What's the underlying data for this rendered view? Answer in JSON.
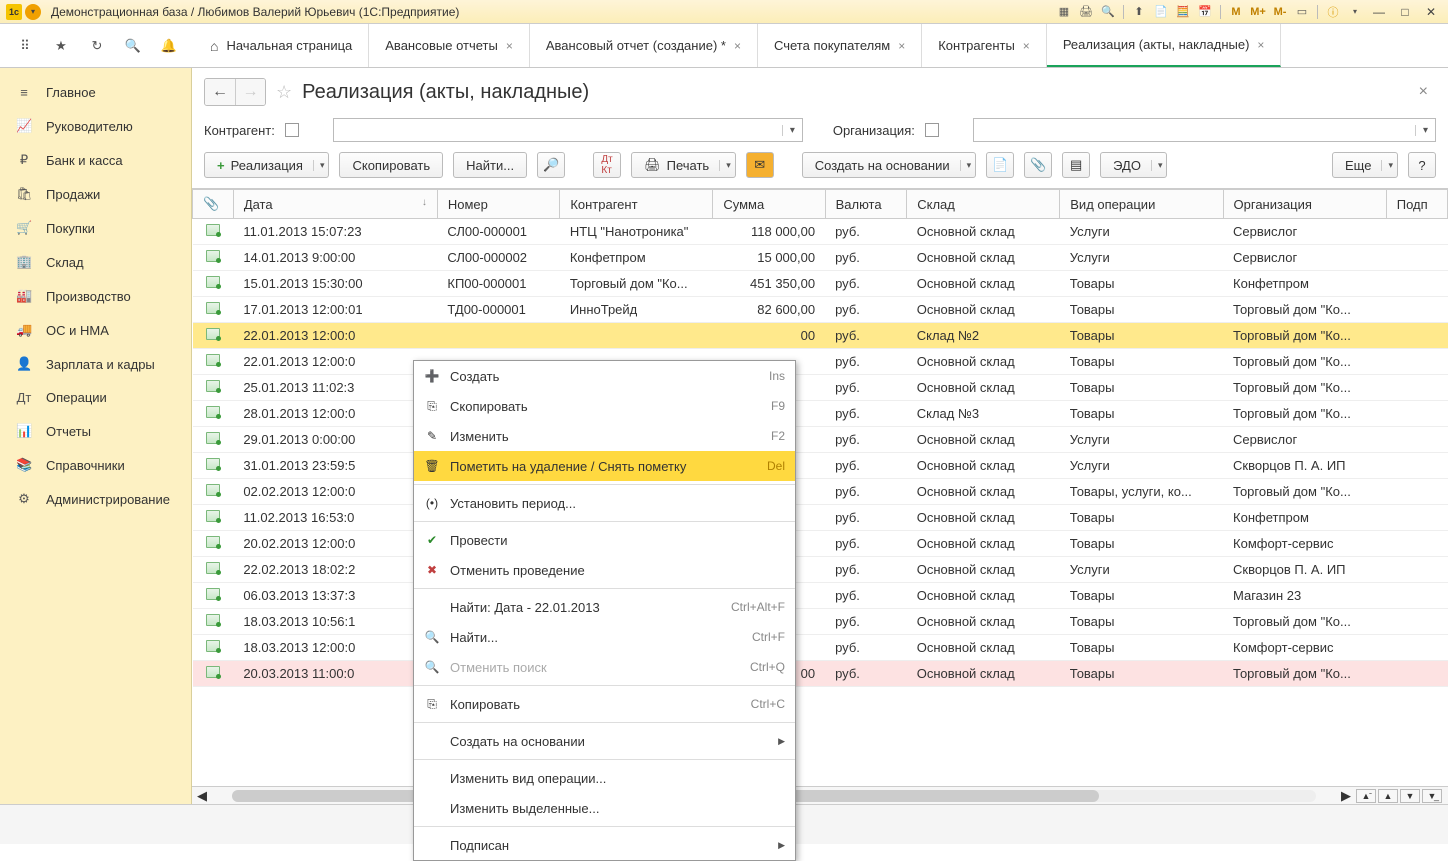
{
  "window": {
    "title": "Демонстрационная база / Любимов Валерий Юрьевич  (1С:Предприятие)"
  },
  "titlebar_right": {
    "m": "M",
    "mp": "M+",
    "mm": "M-"
  },
  "tabs": {
    "home": "Начальная страница",
    "t1": "Авансовые отчеты",
    "t2": "Авансовый отчет (создание) *",
    "t3": "Счета покупателям",
    "t4": "Контрагенты",
    "t5": "Реализация (акты, накладные)"
  },
  "sidebar": [
    {
      "icon": "≡",
      "label": "Главное"
    },
    {
      "icon": "📈",
      "label": "Руководителю"
    },
    {
      "icon": "₽",
      "label": "Банк и касса"
    },
    {
      "icon": "🛍",
      "label": "Продажи"
    },
    {
      "icon": "🛒",
      "label": "Покупки"
    },
    {
      "icon": "🏢",
      "label": "Склад"
    },
    {
      "icon": "🏭",
      "label": "Производство"
    },
    {
      "icon": "🚚",
      "label": "ОС и НМА"
    },
    {
      "icon": "👤",
      "label": "Зарплата и кадры"
    },
    {
      "icon": "Дт",
      "label": "Операции"
    },
    {
      "icon": "📊",
      "label": "Отчеты"
    },
    {
      "icon": "📚",
      "label": "Справочники"
    },
    {
      "icon": "⚙",
      "label": "Администрирование"
    }
  ],
  "page": {
    "title": "Реализация (акты, накладные)"
  },
  "filters": {
    "contragent_label": "Контрагент:",
    "org_label": "Организация:"
  },
  "actions": {
    "create": "Реализация",
    "copy": "Скопировать",
    "find": "Найти...",
    "print": "Печать",
    "create_on_basis": "Создать на основании",
    "edo": "ЭДО",
    "more": "Еще",
    "help": "?"
  },
  "columns": {
    "attach": "📎",
    "date": "Дата",
    "number": "Номер",
    "contragent": "Контрагент",
    "sum": "Сумма",
    "currency": "Валюта",
    "warehouse": "Склад",
    "optype": "Вид операции",
    "org": "Организация",
    "signer": "Подп"
  },
  "rows": [
    {
      "date": "11.01.2013 15:07:23",
      "number": "СЛ00-000001",
      "contr": "НТЦ \"Нанотроника\"",
      "sum": "118 000,00",
      "cur": "руб.",
      "wh": "Основной склад",
      "op": "Услуги",
      "org": "Сервислог"
    },
    {
      "date": "14.01.2013 9:00:00",
      "number": "СЛ00-000002",
      "contr": "Конфетпром",
      "sum": "15 000,00",
      "cur": "руб.",
      "wh": "Основной склад",
      "op": "Услуги",
      "org": "Сервислог"
    },
    {
      "date": "15.01.2013 15:30:00",
      "number": "КП00-000001",
      "contr": "Торговый дом \"Ко...",
      "sum": "451 350,00",
      "cur": "руб.",
      "wh": "Основной склад",
      "op": "Товары",
      "org": "Конфетпром"
    },
    {
      "date": "17.01.2013 12:00:01",
      "number": "ТД00-000001",
      "contr": "ИнноТрейд",
      "sum": "82 600,00",
      "cur": "руб.",
      "wh": "Основной склад",
      "op": "Товары",
      "org": "Торговый дом \"Ко..."
    },
    {
      "date": "22.01.2013 12:00:0",
      "number": "",
      "contr": "",
      "sum": "00",
      "cur": "руб.",
      "wh": "Склад №2",
      "op": "Товары",
      "org": "Торговый дом \"Ко...",
      "sel": true
    },
    {
      "date": "22.01.2013 12:00:0",
      "number": "",
      "contr": "",
      "sum": "",
      "cur": "руб.",
      "wh": "Основной склад",
      "op": "Товары",
      "org": "Торговый дом \"Ко..."
    },
    {
      "date": "25.01.2013 11:02:3",
      "number": "",
      "contr": "",
      "sum": "",
      "cur": "руб.",
      "wh": "Основной склад",
      "op": "Товары",
      "org": "Торговый дом \"Ко..."
    },
    {
      "date": "28.01.2013 12:00:0",
      "number": "",
      "contr": "",
      "sum": "",
      "cur": "руб.",
      "wh": "Склад №3",
      "op": "Товары",
      "org": "Торговый дом \"Ко..."
    },
    {
      "date": "29.01.2013 0:00:00",
      "number": "",
      "contr": "",
      "sum": "",
      "cur": "руб.",
      "wh": "Основной склад",
      "op": "Услуги",
      "org": "Сервислог"
    },
    {
      "date": "31.01.2013 23:59:5",
      "number": "",
      "contr": "",
      "sum": "",
      "cur": "руб.",
      "wh": "Основной склад",
      "op": "Услуги",
      "org": "Скворцов П. А. ИП"
    },
    {
      "date": "02.02.2013 12:00:0",
      "number": "",
      "contr": "",
      "sum": "",
      "cur": "руб.",
      "wh": "Основной склад",
      "op": "Товары, услуги, ко...",
      "org": "Торговый дом \"Ко..."
    },
    {
      "date": "11.02.2013 16:53:0",
      "number": "",
      "contr": "",
      "sum": "",
      "cur": "руб.",
      "wh": "Основной склад",
      "op": "Товары",
      "org": "Конфетпром"
    },
    {
      "date": "20.02.2013 12:00:0",
      "number": "",
      "contr": "",
      "sum": "",
      "cur": "руб.",
      "wh": "Основной склад",
      "op": "Товары",
      "org": "Комфорт-сервис"
    },
    {
      "date": "22.02.2013 18:02:2",
      "number": "",
      "contr": "",
      "sum": "",
      "cur": "руб.",
      "wh": "Основной склад",
      "op": "Услуги",
      "org": "Скворцов П. А. ИП"
    },
    {
      "date": "06.03.2013 13:37:3",
      "number": "",
      "contr": "",
      "sum": "",
      "cur": "руб.",
      "wh": "Основной склад",
      "op": "Товары",
      "org": "Магазин 23"
    },
    {
      "date": "18.03.2013 10:56:1",
      "number": "",
      "contr": "",
      "sum": "",
      "cur": "руб.",
      "wh": "Основной склад",
      "op": "Товары",
      "org": "Торговый дом \"Ко..."
    },
    {
      "date": "18.03.2013 12:00:0",
      "number": "",
      "contr": "",
      "sum": "",
      "cur": "руб.",
      "wh": "Основной склад",
      "op": "Товары",
      "org": "Комфорт-сервис"
    },
    {
      "date": "20.03.2013 11:00:0",
      "number": "",
      "contr": "",
      "sum": "00",
      "cur": "руб.",
      "wh": "Основной склад",
      "op": "Товары",
      "org": "Торговый дом \"Ко...",
      "del": true
    }
  ],
  "context_menu": [
    {
      "icon": "➕",
      "label": "Создать",
      "key": "Ins"
    },
    {
      "icon": "⎘",
      "label": "Скопировать",
      "key": "F9"
    },
    {
      "icon": "✎",
      "label": "Изменить",
      "key": "F2"
    },
    {
      "icon": "🗑",
      "label": "Пометить на удаление / Снять пометку",
      "key": "Del",
      "hl": true
    },
    {
      "icon": "(•)",
      "label": "Установить период...",
      "key": "",
      "sepBefore": true
    },
    {
      "icon": "✔",
      "label": "Провести",
      "key": "",
      "sepBefore": true,
      "iconColor": "#2a8a2a"
    },
    {
      "icon": "✖",
      "label": "Отменить проведение",
      "key": "",
      "iconColor": "#c04040"
    },
    {
      "icon": "",
      "label": "Найти: Дата - 22.01.2013",
      "key": "Ctrl+Alt+F",
      "sepBefore": true
    },
    {
      "icon": "🔍",
      "label": "Найти...",
      "key": "Ctrl+F"
    },
    {
      "icon": "🔍",
      "label": "Отменить поиск",
      "key": "Ctrl+Q",
      "disabled": true
    },
    {
      "icon": "⎘",
      "label": "Копировать",
      "key": "Ctrl+C",
      "sepBefore": true
    },
    {
      "icon": "",
      "label": "Создать на основании",
      "key": "",
      "sub": true,
      "sepBefore": true
    },
    {
      "icon": "",
      "label": "Изменить вид операции...",
      "key": "",
      "sepBefore": true
    },
    {
      "icon": "",
      "label": "Изменить выделенные...",
      "key": ""
    },
    {
      "icon": "",
      "label": "Подписан",
      "key": "",
      "sub": true,
      "sepBefore": true
    }
  ]
}
